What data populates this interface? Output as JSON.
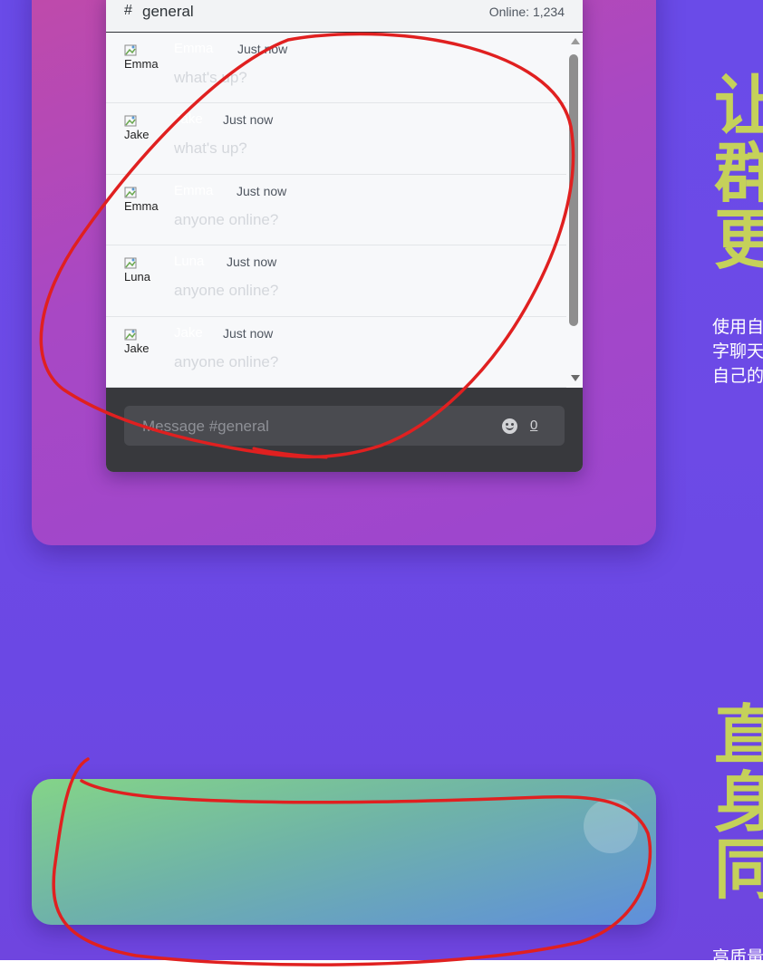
{
  "chat": {
    "channel_hash": "#",
    "channel_name": "general",
    "online": "Online: 1,234",
    "messages": [
      {
        "author": "Emma",
        "time": "Just now",
        "text": "what's up?",
        "avatar_alt": "Emma"
      },
      {
        "author": "Jake",
        "time": "Just now",
        "text": "what's up?",
        "avatar_alt": "Jake"
      },
      {
        "author": "Emma",
        "time": "Just now",
        "text": "anyone online?",
        "avatar_alt": "Emma"
      },
      {
        "author": "Luna",
        "time": "Just now",
        "text": "anyone online?",
        "avatar_alt": "Luna"
      },
      {
        "author": "Jake",
        "time": "Just now",
        "text": "anyone online?",
        "avatar_alt": "Jake"
      }
    ],
    "composer": {
      "placeholder": "Message #general",
      "char_count": "0",
      "emoji_icon": "smile-icon"
    }
  },
  "section1": {
    "heading_lines": [
      "让",
      "群",
      "更"
    ],
    "desc_lines": [
      "使用自",
      "字聊天",
      "自己的"
    ]
  },
  "section2": {
    "heading_lines": [
      "直",
      "身",
      "同"
    ],
    "desc": "高质量"
  },
  "colors": {
    "accent_heading": "#c5d15a",
    "annotation_red": "#e02020",
    "page_purple": "#6b48e4"
  }
}
